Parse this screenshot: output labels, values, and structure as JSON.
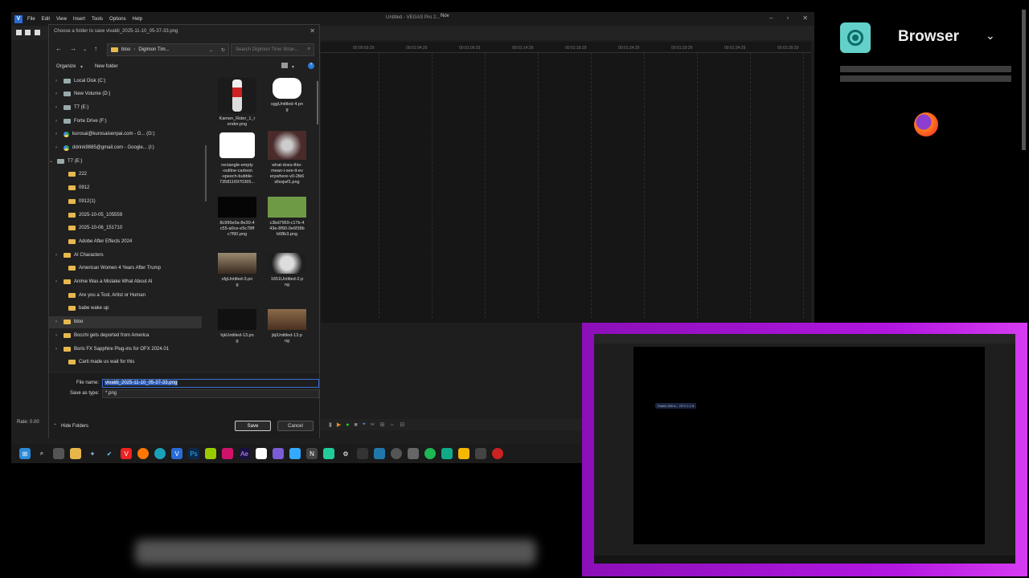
{
  "app": {
    "menu": [
      "File",
      "Edit",
      "View",
      "Insert",
      "Tools",
      "Options",
      "Help"
    ],
    "title": "Untitled - VEGAS Pro 2...",
    "clock": "Nov",
    "rate": "Rate: 0.00",
    "ruler_ticks": [
      "00:00:59:29",
      "00:01:04:29",
      "00:01:09:29",
      "00:01:14:29",
      "00:01:19:29",
      "00:01:24:29",
      "00:01:29:29",
      "00:01:34:29",
      "00:01:39:29",
      "00:01:44:29"
    ]
  },
  "dialog": {
    "title": "Choose a folder to save vivaldi_2025-11-10_05-37-33.png",
    "address": [
      "bloo",
      "Digimon Tim..."
    ],
    "search_placeholder": "Search Digimon Time Stran...",
    "organize": "Organize",
    "new_folder": "New folder",
    "tree": [
      {
        "label": "Local Disk (C:)",
        "icon": "drive",
        "expand": true,
        "indent": 0
      },
      {
        "label": "New Volume (D:)",
        "icon": "drive",
        "expand": true,
        "indent": 0
      },
      {
        "label": "T7 (E:)",
        "icon": "drive",
        "expand": true,
        "indent": 0
      },
      {
        "label": "Forte Drive (F:)",
        "icon": "drive",
        "expand": true,
        "indent": 0
      },
      {
        "label": "kurosai@kurosaisenpai.com - G... (G:)",
        "icon": "gdrive",
        "expand": true,
        "indent": 0
      },
      {
        "label": "ddrink9885@gmail.com - Google... (I:)",
        "icon": "gdrive",
        "expand": true,
        "indent": 0
      },
      {
        "label": "T7 (E:)",
        "icon": "drive",
        "expand": "open",
        "indent": -1
      },
      {
        "label": "222",
        "icon": "folder",
        "expand": false,
        "indent": 1
      },
      {
        "label": "0912",
        "icon": "folder",
        "expand": false,
        "indent": 1
      },
      {
        "label": "0912(1)",
        "icon": "folder",
        "expand": false,
        "indent": 1
      },
      {
        "label": "2025-10-05_105559",
        "icon": "folder",
        "expand": false,
        "indent": 1
      },
      {
        "label": "2025-10-06_151710",
        "icon": "folder",
        "expand": false,
        "indent": 1
      },
      {
        "label": "Adobe After Effects 2024",
        "icon": "folder",
        "expand": false,
        "indent": 1
      },
      {
        "label": "AI Characters",
        "icon": "folder",
        "expand": true,
        "indent": 0
      },
      {
        "label": "American Women 4 Years After Trump",
        "icon": "folder",
        "expand": false,
        "indent": 1
      },
      {
        "label": "Anime Was a Mistake What About AI",
        "icon": "folder",
        "expand": true,
        "indent": 0
      },
      {
        "label": "Are you a Tool, Artist or Human",
        "icon": "folder",
        "expand": false,
        "indent": 1
      },
      {
        "label": "babe wake up",
        "icon": "folder",
        "expand": false,
        "indent": 1
      },
      {
        "label": "bloo",
        "icon": "folder",
        "expand": true,
        "indent": 0,
        "selected": true
      },
      {
        "label": "Bocchi gets deported from America",
        "icon": "folder",
        "expand": true,
        "indent": 0
      },
      {
        "label": "Boris FX Sapphire Plug-ins for OFX 2024.01",
        "icon": "folder",
        "expand": true,
        "indent": 0
      },
      {
        "label": "Carti made us wait for this",
        "icon": "folder",
        "expand": false,
        "indent": 1
      }
    ],
    "files": [
      {
        "name": "Kamen_Rider_1_render.png",
        "lines": [
          "Kamen_Rider_1_r",
          "ender.png"
        ],
        "thumb": "figure"
      },
      {
        "name": "sggUntitled-4.png",
        "lines": [
          "sggUntitled-4.pn",
          "g"
        ],
        "thumb": "bubble-white"
      },
      {
        "name": "rectangle-empty-outline-cartoon-speech-bubble",
        "lines": [
          "rectangle-empty",
          "-outline-cartoon",
          "-speech-bubble-",
          "7358116970365..."
        ],
        "thumb": "bubble-outline"
      },
      {
        "name": "what-does-this-mean",
        "lines": [
          "what-does-this-",
          "mean-i-see-it-ev",
          "erywhere-v0-2tk6",
          "sllssjwf1.png"
        ],
        "thumb": "rabbit"
      },
      {
        "name": "8c996e0a",
        "lines": [
          "8c996e0a-8e30-4",
          "c55-a0ce-e5c78ff",
          "c7f90.png"
        ],
        "thumb": "black"
      },
      {
        "name": "c3bd7969",
        "lines": [
          "c3bd7969-c17b-4",
          "43e-8f90-0e6f38b",
          "b08b3.png"
        ],
        "thumb": "green"
      },
      {
        "name": "sfgUntitled-3.png",
        "lines": [
          "sfgUntitled-3.pn",
          "g"
        ],
        "thumb": "ring"
      },
      {
        "name": "1651Untitled-2.png",
        "lines": [
          "1651Untitled-2.p",
          "ng"
        ],
        "thumb": "robot"
      },
      {
        "name": "hjkUntitled-13.png",
        "lines": [
          "hjkUntitled-13.pn",
          "g"
        ],
        "thumb": "dark"
      },
      {
        "name": "jkjlUntitled-13.png",
        "lines": [
          "jkjlUntitled-13.p",
          "ng"
        ],
        "thumb": "brown"
      }
    ],
    "file_name_label": "File name:",
    "file_name_value": "vivaldi_2025-11-10_05-37-33.png",
    "save_type_label": "Save as type:",
    "save_type_value": "*.png",
    "hide_folders": "Hide Folders",
    "save": "Save",
    "cancel": "Cancel"
  },
  "overlay": {
    "browser_label": "Browser"
  },
  "pip": {
    "tag": "Stable Diffus... OFX 1.1 ▾"
  },
  "colors": {
    "accent": "#2f5fb8",
    "pip_border": "#b216e0",
    "browser_icon": "#63d1c9"
  }
}
